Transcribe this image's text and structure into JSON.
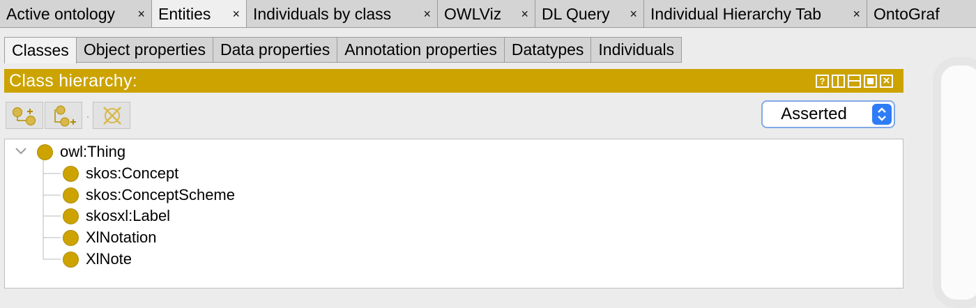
{
  "top_tabs": [
    {
      "label": "Active ontology",
      "close": "×",
      "active": false
    },
    {
      "label": "Entities",
      "close": "×",
      "active": true
    },
    {
      "label": "Individuals by class",
      "close": "×",
      "active": false
    },
    {
      "label": "OWLViz",
      "close": "×",
      "active": false
    },
    {
      "label": "DL Query",
      "close": "×",
      "active": false
    },
    {
      "label": "Individual Hierarchy Tab",
      "close": "×",
      "active": false
    },
    {
      "label": "OntoGraf",
      "close": "",
      "active": false
    }
  ],
  "sub_tabs": [
    {
      "label": "Classes",
      "active": true
    },
    {
      "label": "Object properties",
      "active": false
    },
    {
      "label": "Data properties",
      "active": false
    },
    {
      "label": "Annotation properties",
      "active": false
    },
    {
      "label": "Datatypes",
      "active": false
    },
    {
      "label": "Individuals",
      "active": false
    }
  ],
  "view": {
    "title": "Class hierarchy:",
    "controls": [
      "help-icon",
      "split-vertical-icon",
      "split-horizontal-icon",
      "maximize-icon",
      "close-icon"
    ],
    "help_glyph": "?",
    "close_glyph": "×"
  },
  "toolbar": {
    "buttons": [
      "add-subclass-icon",
      "add-sibling-class-icon",
      "delete-class-icon"
    ],
    "dot": "·"
  },
  "hierarchy_mode": {
    "selected": "Asserted"
  },
  "tree": {
    "root": {
      "label": "owl:Thing",
      "expanded": true
    },
    "children": [
      {
        "label": "skos:Concept"
      },
      {
        "label": "skos:ConceptScheme"
      },
      {
        "label": "skosxl:Label"
      },
      {
        "label": "XlNotation"
      },
      {
        "label": "XlNote"
      }
    ]
  },
  "colors": {
    "class_gold": "#cca300",
    "header_gold": "#cca300",
    "select_blue": "#2e7cf6"
  }
}
